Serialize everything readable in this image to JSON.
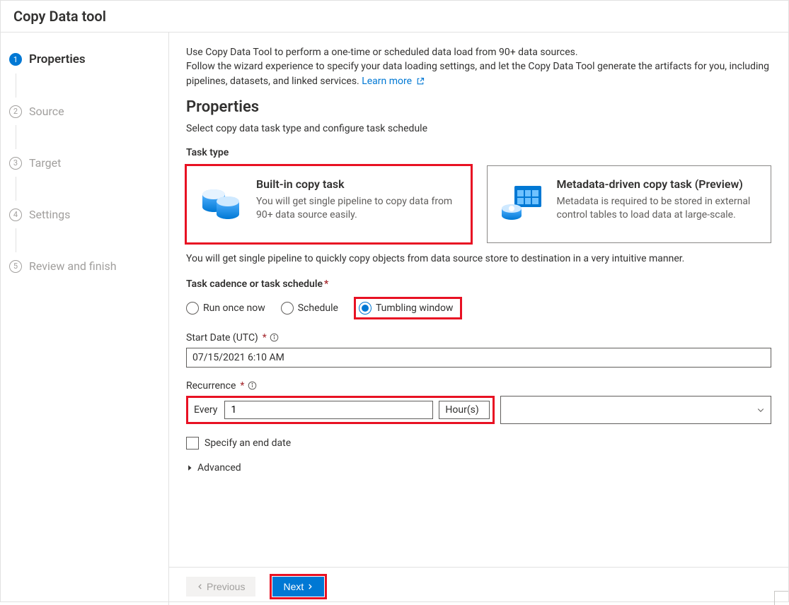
{
  "header": {
    "title": "Copy Data tool"
  },
  "sidebar": {
    "steps": [
      {
        "num": "1",
        "label": "Properties",
        "active": true
      },
      {
        "num": "2",
        "label": "Source",
        "active": false
      },
      {
        "num": "3",
        "label": "Target",
        "active": false
      },
      {
        "num": "4",
        "label": "Settings",
        "active": false
      },
      {
        "num": "5",
        "label": "Review and finish",
        "active": false
      }
    ]
  },
  "intro": {
    "line1": "Use Copy Data Tool to perform a one-time or scheduled data load from 90+ data sources.",
    "line2a": "Follow the wizard experience to specify your data loading settings, and let the Copy Data Tool generate the artifacts for you, including pipelines, datasets, and linked services. ",
    "learn_more": "Learn more"
  },
  "properties": {
    "heading": "Properties",
    "desc": "Select copy data task type and configure task schedule"
  },
  "task_type": {
    "label": "Task type",
    "cards": [
      {
        "title": "Built-in copy task",
        "desc": "You will get single pipeline to copy data from 90+ data source easily.",
        "selected": true
      },
      {
        "title": "Metadata-driven copy task (Preview)",
        "desc": "Metadata is required to be stored in external control tables to load data at large-scale.",
        "selected": false
      }
    ],
    "hint": "You will get single pipeline to quickly copy objects from data source store to destination in a very intuitive manner."
  },
  "cadence": {
    "label": "Task cadence or task schedule",
    "options": [
      {
        "label": "Run once now",
        "selected": false
      },
      {
        "label": "Schedule",
        "selected": false
      },
      {
        "label": "Tumbling window",
        "selected": true
      }
    ]
  },
  "start_date": {
    "label": "Start Date (UTC)",
    "value": "07/15/2021 6:10 AM"
  },
  "recurrence": {
    "label": "Recurrence",
    "every": "Every",
    "value": "1",
    "unit": "Hour(s)"
  },
  "end_date": {
    "label": "Specify an end date"
  },
  "advanced": {
    "label": "Advanced"
  },
  "footer": {
    "previous": "Previous",
    "next": "Next"
  }
}
